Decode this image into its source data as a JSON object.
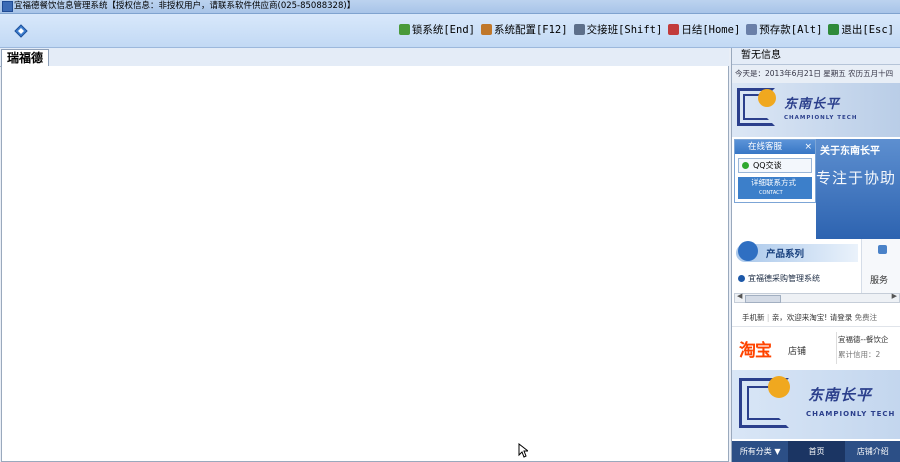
{
  "window": {
    "title": "宜福德餐饮信息管理系统【授权信息：非授权用户，请联系软件供应商(025-85088328)】"
  },
  "toolbar": {
    "items": [
      {
        "label": "锁系统[End]",
        "icon": "lock-icon",
        "color": "#4a9a3a"
      },
      {
        "label": "系统配置[F12]",
        "icon": "settings-grid-icon",
        "color": "#c0772a"
      },
      {
        "label": "交接班[Shift]",
        "icon": "shift-handover-icon",
        "color": "#5d6f8a"
      },
      {
        "label": "日结[Home]",
        "icon": "calendar-icon",
        "color": "#c23b3b"
      },
      {
        "label": "预存款[Alt]",
        "icon": "deposit-icon",
        "color": "#6a7fa8"
      },
      {
        "label": "退出[Esc]",
        "icon": "exit-icon",
        "color": "#2f8a3a"
      }
    ]
  },
  "main": {
    "tabs": [
      {
        "label": "瑞福德"
      }
    ]
  },
  "side": {
    "header": "暂无信息",
    "date_line": "今天是：2013年6月21日  星期五  农历五月十四",
    "banner": {
      "title_cn": "东南长平",
      "title_en": "CHAMPIONLY TECH",
      "accent": "#2b3f8c",
      "sun": "#f0a81f"
    },
    "online": {
      "title": "在线客服",
      "close": "×",
      "qq": "QQ交谈",
      "detail": "详细联系方式",
      "detail_en": "CONTACT"
    },
    "about": {
      "title": "关于东南长平",
      "slogan": "专注于协助"
    },
    "product": {
      "title": "产品系列",
      "item": "宜福德采购管理系统"
    },
    "service": {
      "label": "服务"
    },
    "strip": {
      "mobile": "手机新",
      "welcome": "亲，欢迎来淘宝!",
      "login": "请登录",
      "register": "免费注"
    },
    "shop": {
      "logo": "淘宝",
      "sub": "店铺",
      "name": "宜福德--餐饮企",
      "credit": "累计信用：2",
      "brand_color": "#ff4400"
    },
    "nav": [
      {
        "label": "所有分类 ▼"
      },
      {
        "label": "首页"
      },
      {
        "label": "店铺介绍"
      }
    ]
  }
}
